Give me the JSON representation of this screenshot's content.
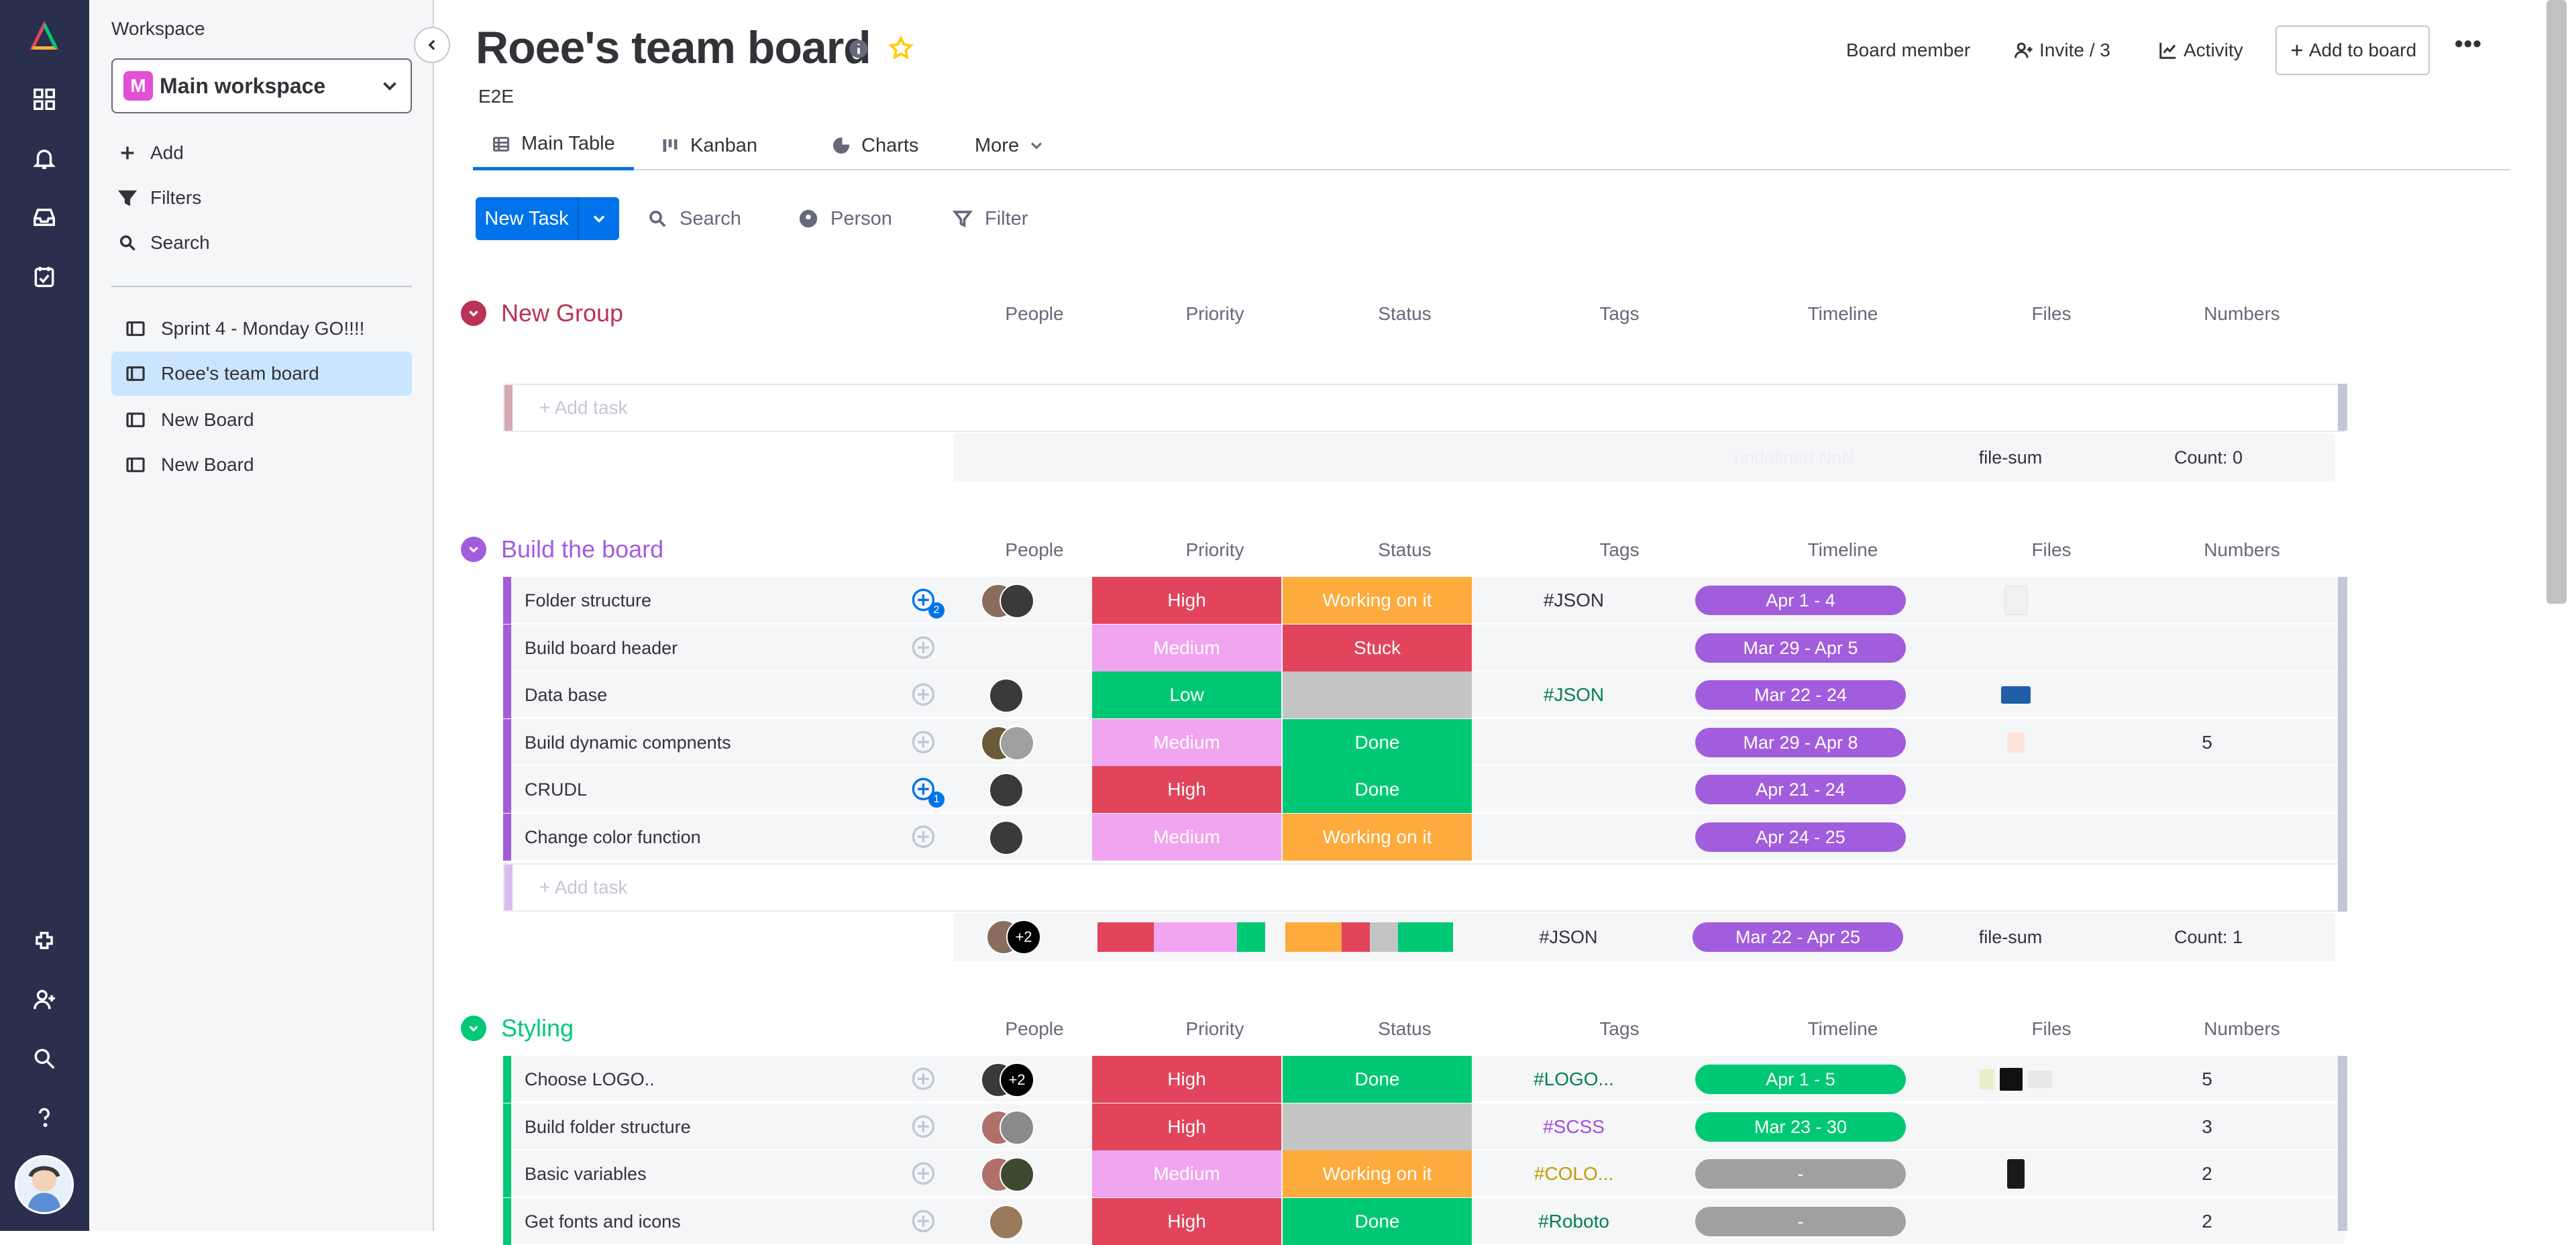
{
  "sidepanel": {
    "workspace_label": "Workspace",
    "workspace_badge": "M",
    "workspace_name": "Main workspace",
    "actions": {
      "add": "Add",
      "filters": "Filters",
      "search": "Search"
    },
    "boards": [
      "Sprint 4 - Monday GO!!!!",
      "Roee's team board",
      "New Board",
      "New Board"
    ]
  },
  "header": {
    "title": "Roee's team board",
    "subtitle": "E2E",
    "board_member": "Board member",
    "invite": "Invite / 3",
    "activity": "Activity",
    "add_to_board": "Add to board",
    "more": "•••"
  },
  "tabs": [
    "Main Table",
    "Kanban",
    "Charts",
    "More"
  ],
  "toolbar": {
    "new_task": "New Task",
    "search": "Search",
    "person": "Person",
    "filter": "Filter"
  },
  "columns": [
    "People",
    "Priority",
    "Status",
    "Tags",
    "Timeline",
    "Files",
    "Numbers"
  ],
  "colors": {
    "high": "#e2445c",
    "medium": "#f1a4ef",
    "low": "#00c875",
    "working": "#fdab3d",
    "stuck": "#e2445c",
    "done": "#00c875",
    "empty": "#c4c4c4",
    "timeline_purple": "#a25ddc",
    "timeline_green": "#00c875",
    "timeline_gray": "#a0a0a0",
    "group_new": "#bb3354",
    "group_build": "#a25ddc",
    "group_styling": "#00c875"
  },
  "groups": [
    {
      "title": "New Group",
      "add_task": "+ Add task",
      "summary": {
        "timeline": "undefined NaN",
        "files": "file-sum",
        "numbers": "Count: 0"
      }
    },
    {
      "title": "Build the board",
      "add_task": "+ Add task",
      "rows": [
        {
          "name": "Folder structure",
          "badge": "2",
          "priority": "High",
          "status": "Working on it",
          "tag": "#JSON",
          "timeline": "Apr 1 - 4",
          "numbers": ""
        },
        {
          "name": "Build board header",
          "badge": "",
          "priority": "Medium",
          "status": "Stuck",
          "tag": "",
          "timeline": "Mar 29 - Apr 5",
          "numbers": ""
        },
        {
          "name": "Data base",
          "badge": "",
          "priority": "Low",
          "status": "",
          "tag": "#JSON",
          "timeline": "Mar 22 - 24",
          "numbers": ""
        },
        {
          "name": "Build dynamic compnents",
          "badge": "",
          "priority": "Medium",
          "status": "Done",
          "tag": "",
          "timeline": "Mar 29 - Apr 8",
          "numbers": "5"
        },
        {
          "name": "CRUDL",
          "badge": "1",
          "priority": "High",
          "status": "Done",
          "tag": "",
          "timeline": "Apr 21 - 24",
          "numbers": ""
        },
        {
          "name": "Change color function",
          "badge": "",
          "priority": "Medium",
          "status": "Working on it",
          "tag": "",
          "timeline": "Apr 24 - 25",
          "numbers": ""
        }
      ],
      "summary": {
        "people_more": "+2",
        "tags": "#JSON",
        "timeline": "Mar 22 - Apr 25",
        "files": "file-sum",
        "numbers": "Count: 1"
      }
    },
    {
      "title": "Styling",
      "rows": [
        {
          "name": "Choose LOGO..",
          "priority": "High",
          "status": "Done",
          "tag": "#LOGO...",
          "timeline": "Apr 1 - 5",
          "numbers": "5",
          "people_more": "+2"
        },
        {
          "name": "Build folder structure",
          "priority": "High",
          "status": "",
          "tag": "#SCSS",
          "timeline": "Mar 23 - 30",
          "numbers": "3"
        },
        {
          "name": "Basic variables",
          "priority": "Medium",
          "status": "Working on it",
          "tag": "#COLO...",
          "timeline": "-",
          "numbers": "2"
        },
        {
          "name": "Get fonts and icons",
          "priority": "High",
          "status": "Done",
          "tag": "#Roboto",
          "timeline": "-",
          "numbers": "2"
        }
      ]
    }
  ]
}
